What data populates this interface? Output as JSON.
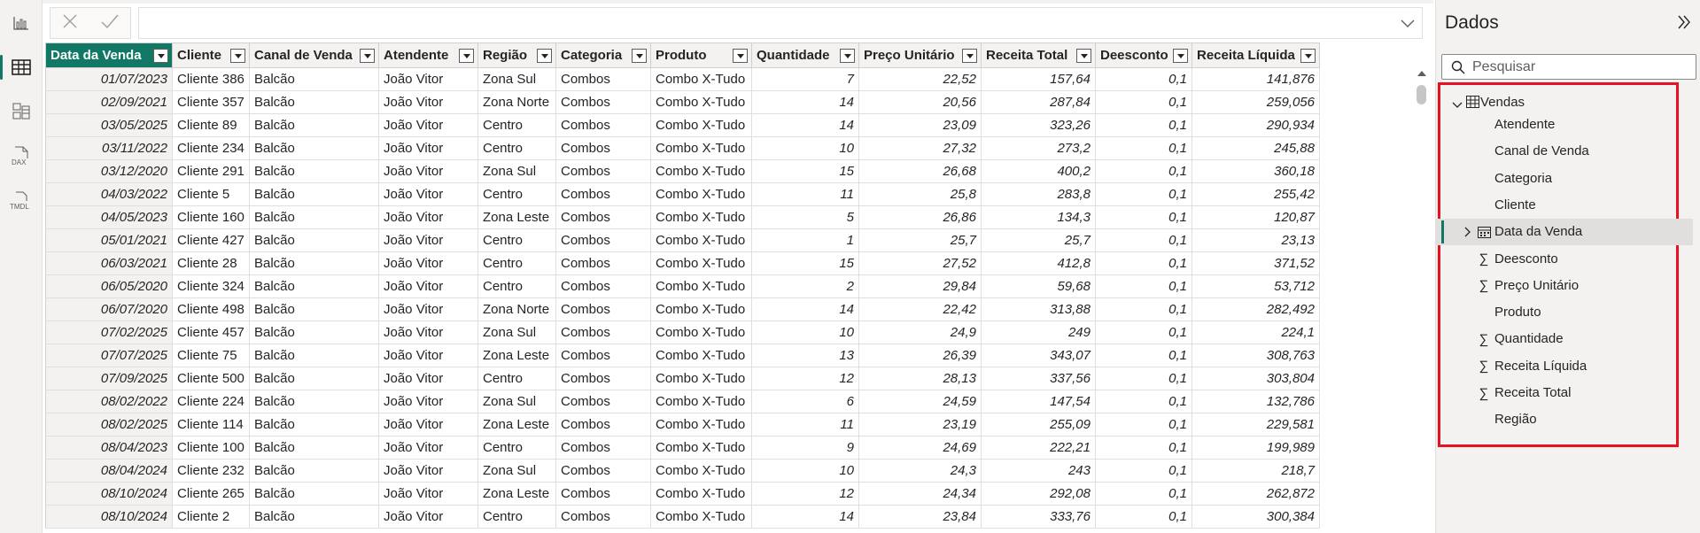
{
  "rail": {
    "icons": [
      "report-view-icon",
      "table-view-icon",
      "model-view-icon",
      "dax-query-view-icon",
      "tmdl-view-icon"
    ],
    "dax_label": "DAX",
    "tmdl_label": "TMDL"
  },
  "table": {
    "columns": [
      "Data da Venda",
      "Cliente",
      "Canal de Venda",
      "Atendente",
      "Região",
      "Categoria",
      "Produto",
      "Quantidade",
      "Preço Unitário",
      "Receita Total",
      "Deesconto",
      "Receita Líquida"
    ],
    "rows": [
      [
        "01/07/2023",
        "Cliente 386",
        "Balcão",
        "João Vitor",
        "Zona Sul",
        "Combos",
        "Combo X-Tudo",
        "7",
        "22,52",
        "157,64",
        "0,1",
        "141,876"
      ],
      [
        "02/09/2021",
        "Cliente 357",
        "Balcão",
        "João Vitor",
        "Zona Norte",
        "Combos",
        "Combo X-Tudo",
        "14",
        "20,56",
        "287,84",
        "0,1",
        "259,056"
      ],
      [
        "03/05/2025",
        "Cliente 89",
        "Balcão",
        "João Vitor",
        "Centro",
        "Combos",
        "Combo X-Tudo",
        "14",
        "23,09",
        "323,26",
        "0,1",
        "290,934"
      ],
      [
        "03/11/2022",
        "Cliente 234",
        "Balcão",
        "João Vitor",
        "Centro",
        "Combos",
        "Combo X-Tudo",
        "10",
        "27,32",
        "273,2",
        "0,1",
        "245,88"
      ],
      [
        "03/12/2020",
        "Cliente 291",
        "Balcão",
        "João Vitor",
        "Zona Sul",
        "Combos",
        "Combo X-Tudo",
        "15",
        "26,68",
        "400,2",
        "0,1",
        "360,18"
      ],
      [
        "04/03/2022",
        "Cliente 5",
        "Balcão",
        "João Vitor",
        "Centro",
        "Combos",
        "Combo X-Tudo",
        "11",
        "25,8",
        "283,8",
        "0,1",
        "255,42"
      ],
      [
        "04/05/2023",
        "Cliente 160",
        "Balcão",
        "João Vitor",
        "Zona Leste",
        "Combos",
        "Combo X-Tudo",
        "5",
        "26,86",
        "134,3",
        "0,1",
        "120,87"
      ],
      [
        "05/01/2021",
        "Cliente 427",
        "Balcão",
        "João Vitor",
        "Centro",
        "Combos",
        "Combo X-Tudo",
        "1",
        "25,7",
        "25,7",
        "0,1",
        "23,13"
      ],
      [
        "06/03/2021",
        "Cliente 28",
        "Balcão",
        "João Vitor",
        "Centro",
        "Combos",
        "Combo X-Tudo",
        "15",
        "27,52",
        "412,8",
        "0,1",
        "371,52"
      ],
      [
        "06/05/2020",
        "Cliente 324",
        "Balcão",
        "João Vitor",
        "Centro",
        "Combos",
        "Combo X-Tudo",
        "2",
        "29,84",
        "59,68",
        "0,1",
        "53,712"
      ],
      [
        "06/07/2020",
        "Cliente 498",
        "Balcão",
        "João Vitor",
        "Zona Norte",
        "Combos",
        "Combo X-Tudo",
        "14",
        "22,42",
        "313,88",
        "0,1",
        "282,492"
      ],
      [
        "07/02/2025",
        "Cliente 457",
        "Balcão",
        "João Vitor",
        "Zona Sul",
        "Combos",
        "Combo X-Tudo",
        "10",
        "24,9",
        "249",
        "0,1",
        "224,1"
      ],
      [
        "07/07/2025",
        "Cliente 75",
        "Balcão",
        "João Vitor",
        "Zona Leste",
        "Combos",
        "Combo X-Tudo",
        "13",
        "26,39",
        "343,07",
        "0,1",
        "308,763"
      ],
      [
        "07/09/2025",
        "Cliente 500",
        "Balcão",
        "João Vitor",
        "Centro",
        "Combos",
        "Combo X-Tudo",
        "12",
        "28,13",
        "337,56",
        "0,1",
        "303,804"
      ],
      [
        "08/02/2022",
        "Cliente 224",
        "Balcão",
        "João Vitor",
        "Zona Sul",
        "Combos",
        "Combo X-Tudo",
        "6",
        "24,59",
        "147,54",
        "0,1",
        "132,786"
      ],
      [
        "08/02/2025",
        "Cliente 114",
        "Balcão",
        "João Vitor",
        "Zona Leste",
        "Combos",
        "Combo X-Tudo",
        "11",
        "23,19",
        "255,09",
        "0,1",
        "229,581"
      ],
      [
        "08/04/2023",
        "Cliente 100",
        "Balcão",
        "João Vitor",
        "Centro",
        "Combos",
        "Combo X-Tudo",
        "9",
        "24,69",
        "222,21",
        "0,1",
        "199,989"
      ],
      [
        "08/04/2024",
        "Cliente 232",
        "Balcão",
        "João Vitor",
        "Zona Sul",
        "Combos",
        "Combo X-Tudo",
        "10",
        "24,3",
        "243",
        "0,1",
        "218,7"
      ],
      [
        "08/10/2024",
        "Cliente 265",
        "Balcão",
        "João Vitor",
        "Zona Leste",
        "Combos",
        "Combo X-Tudo",
        "12",
        "24,34",
        "292,08",
        "0,1",
        "262,872"
      ],
      [
        "08/10/2024",
        "Cliente 2",
        "Balcão",
        "João Vitor",
        "Centro",
        "Combos",
        "Combo X-Tudo",
        "14",
        "23,84",
        "333,76",
        "0,1",
        "300,384"
      ]
    ]
  },
  "data_pane": {
    "title": "Dados",
    "search_placeholder": "Pesquisar",
    "table_name": "Vendas",
    "fields": [
      {
        "label": "Atendente",
        "icon": "none"
      },
      {
        "label": "Canal de Venda",
        "icon": "none"
      },
      {
        "label": "Categoria",
        "icon": "none"
      },
      {
        "label": "Cliente",
        "icon": "none"
      },
      {
        "label": "Data da Venda",
        "icon": "calendar-icon",
        "selected": true
      },
      {
        "label": "Deesconto",
        "icon": "sigma-icon"
      },
      {
        "label": "Preço Unitário",
        "icon": "sigma-icon"
      },
      {
        "label": "Produto",
        "icon": "none"
      },
      {
        "label": "Quantidade",
        "icon": "sigma-icon"
      },
      {
        "label": "Receita Líquida",
        "icon": "sigma-icon"
      },
      {
        "label": "Receita Total",
        "icon": "sigma-icon"
      },
      {
        "label": "Região",
        "icon": "none"
      }
    ]
  },
  "colors": {
    "accent": "#117865",
    "highlight_box": "#e81123"
  }
}
